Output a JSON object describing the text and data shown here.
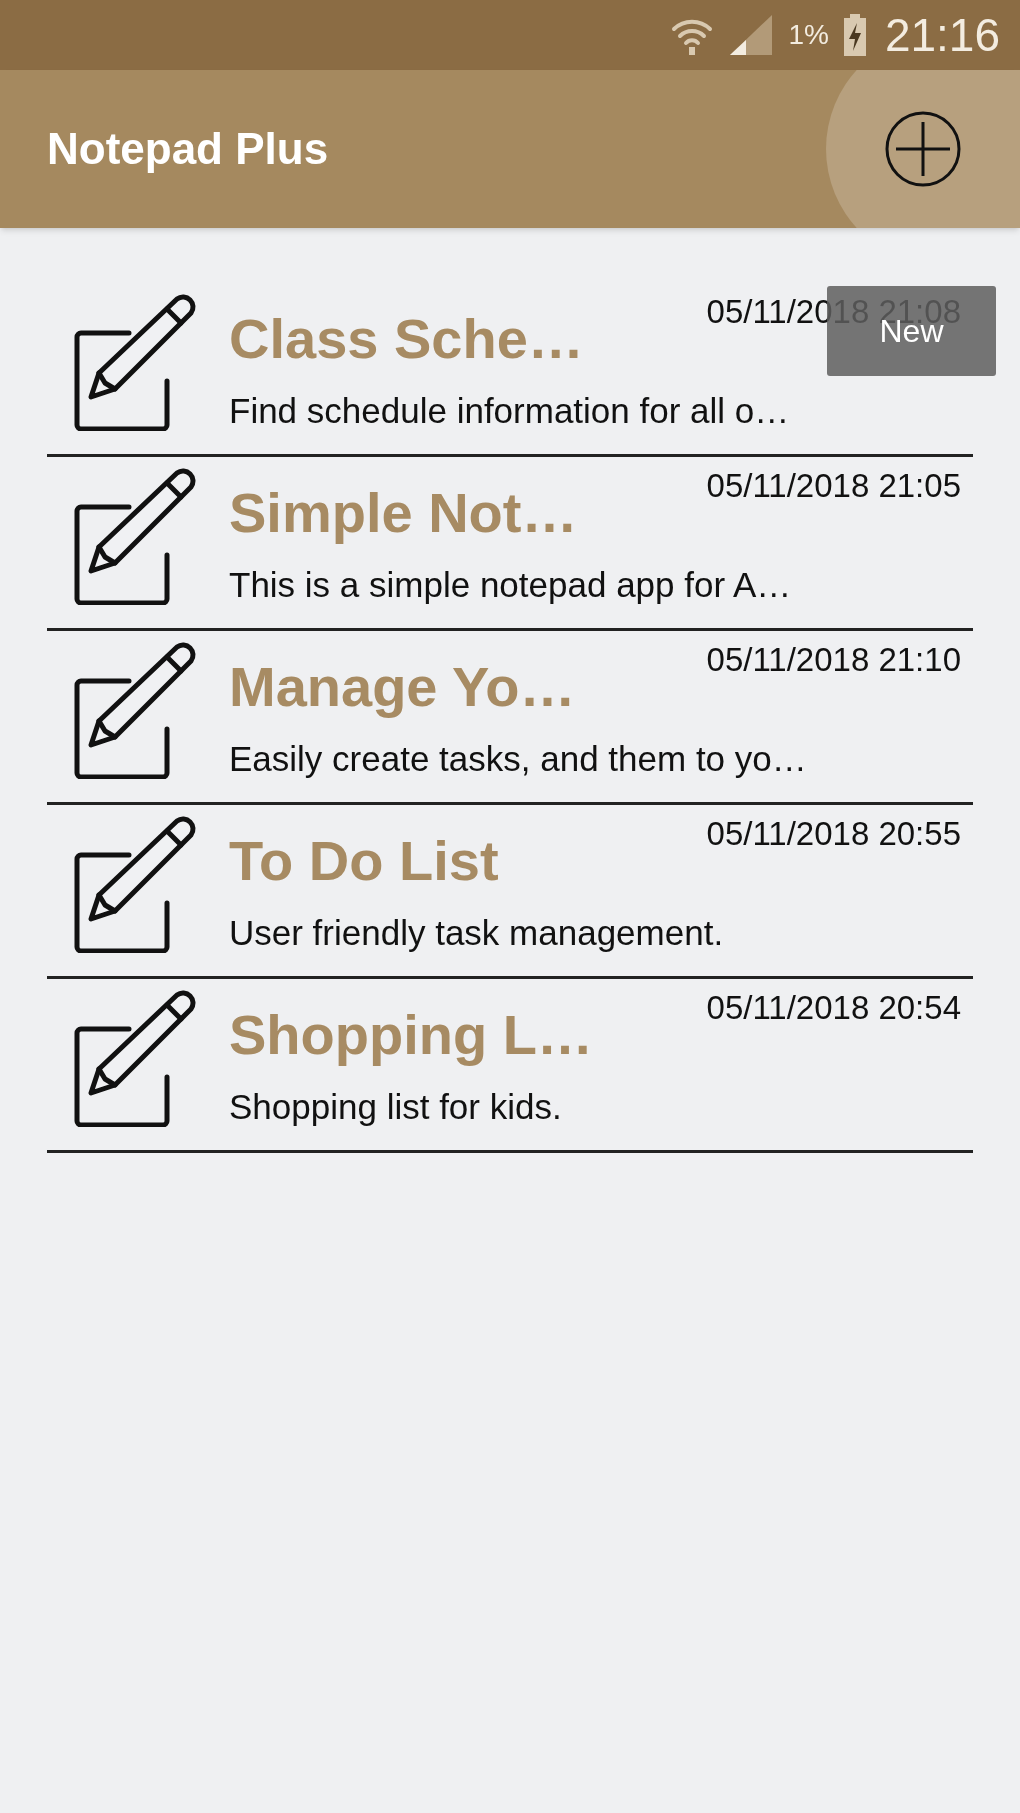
{
  "status_bar": {
    "battery_text": "1%",
    "time": "21:16"
  },
  "app_bar": {
    "title": "Notepad Plus"
  },
  "notes": [
    {
      "title": "Class Sche…",
      "date": "05/11/2018 21:08",
      "description": "Find schedule information for all o…"
    },
    {
      "title": "Simple Not…",
      "date": "05/11/2018 21:05",
      "description": "This is a simple notepad app for A…"
    },
    {
      "title": "Manage Yo…",
      "date": "05/11/2018 21:10",
      "description": "Easily create tasks, and them to yo…"
    },
    {
      "title": "To Do List",
      "date": "05/11/2018 20:55",
      "description": "User friendly task management."
    },
    {
      "title": "Shopping L…",
      "date": "05/11/2018 20:54",
      "description": "Shopping list for kids."
    }
  ],
  "toast": {
    "text": "New"
  }
}
